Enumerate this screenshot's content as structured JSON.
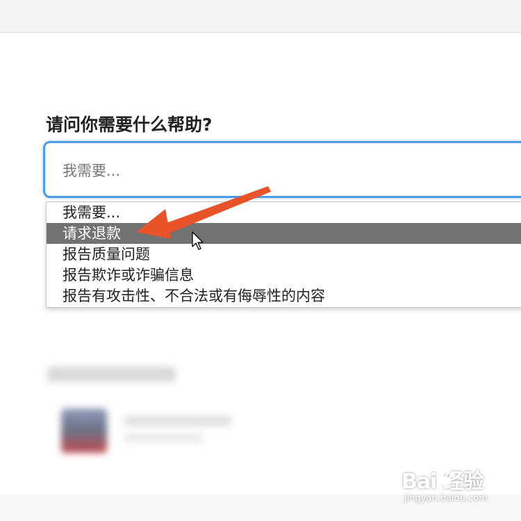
{
  "form": {
    "question": "请问你需要什么帮助?",
    "select_value": "我需要..."
  },
  "dropdown": {
    "options": [
      {
        "label": "我需要...",
        "selected": false
      },
      {
        "label": "请求退款",
        "selected": true
      },
      {
        "label": "报告质量问题",
        "selected": false
      },
      {
        "label": "报告欺诈或诈骗信息",
        "selected": false
      },
      {
        "label": "报告有攻击性、不合法或有侮辱性的内容",
        "selected": false
      }
    ]
  },
  "annotation": {
    "arrow_color": "#e8532a",
    "cursor_icon": "mouse-pointer-icon"
  },
  "watermark": {
    "main": "Bai 经验",
    "sub": "jingyan.baidu.com"
  },
  "colors": {
    "focus_border": "#4a9be8",
    "selected_option_bg": "#727272"
  }
}
